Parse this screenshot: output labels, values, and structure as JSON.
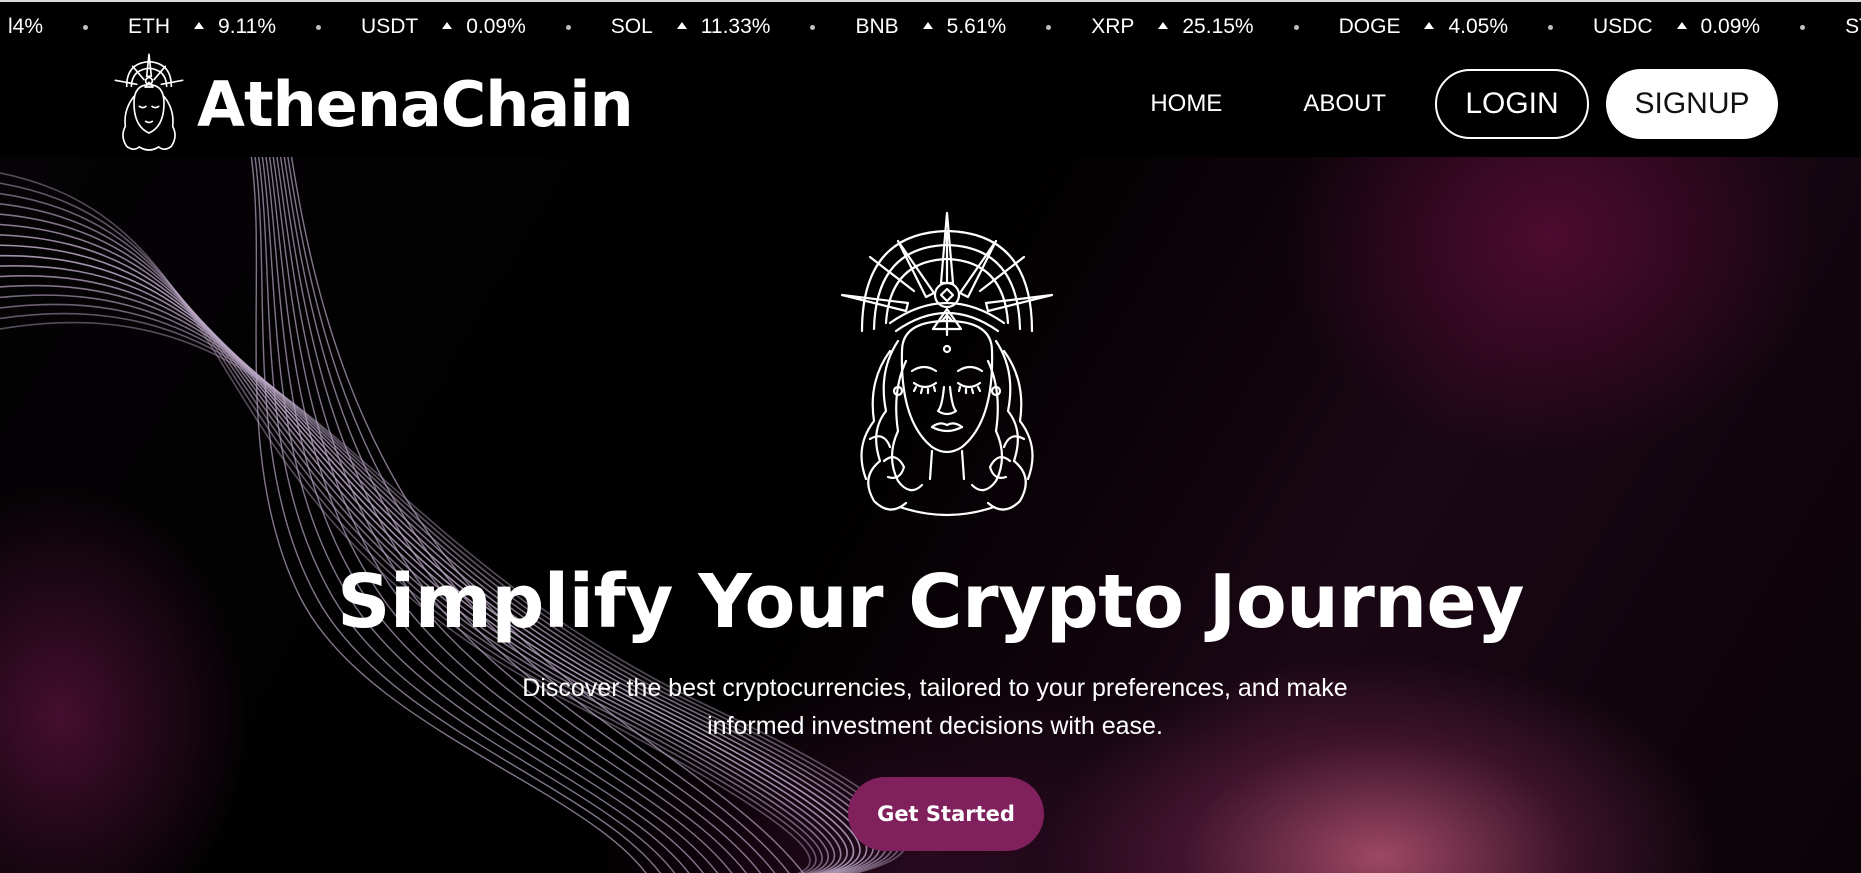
{
  "ticker": {
    "lead_fragment": "l4%",
    "items": [
      {
        "symbol": "ETH",
        "change": "9.11%"
      },
      {
        "symbol": "USDT",
        "change": "0.09%"
      },
      {
        "symbol": "SOL",
        "change": "11.33%"
      },
      {
        "symbol": "BNB",
        "change": "5.61%"
      },
      {
        "symbol": "XRP",
        "change": "25.15%"
      },
      {
        "symbol": "DOGE",
        "change": "4.05%"
      },
      {
        "symbol": "USDC",
        "change": "0.09%"
      },
      {
        "symbol": "STETH",
        "change": ""
      }
    ]
  },
  "header": {
    "brand_name": "AthenaChain",
    "logo_icon": "athena-goddess-head",
    "nav": {
      "home": "HOME",
      "about": "ABOUT",
      "login": "LOGIN",
      "signup": "SIGNUP"
    }
  },
  "hero": {
    "emblem_icon": "athena-goddess-head",
    "title": "Simplify Your Crypto Journey",
    "subtitle": "Discover the best cryptocurrencies, tailored to your preferences, and make informed investment decisions with ease.",
    "cta_label": "Get Started"
  },
  "colors": {
    "background": "#000000",
    "cta": "#80205c",
    "accent_glow": "#d76487",
    "wave_lines": "#b9a6c4",
    "text": "#ffffff"
  }
}
